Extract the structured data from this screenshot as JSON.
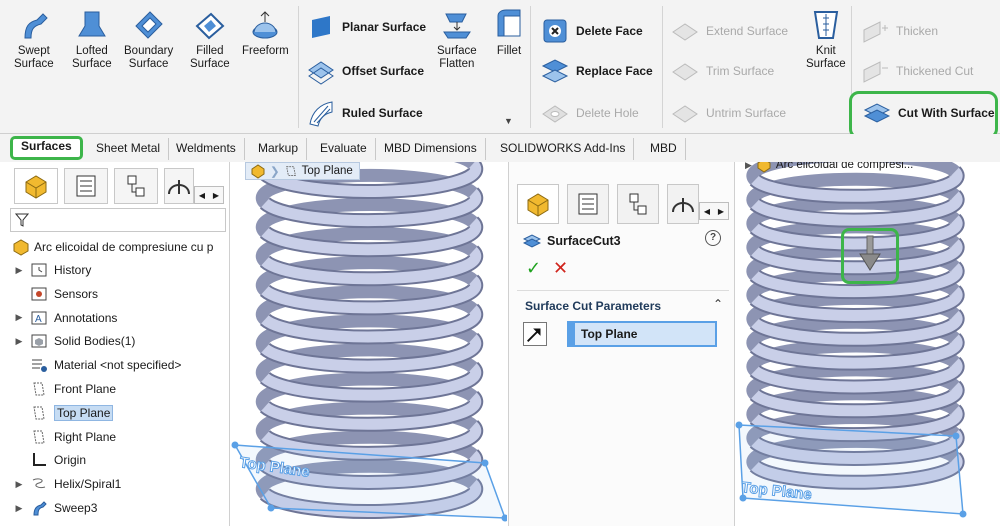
{
  "ribbon": {
    "surfaces_group": [
      {
        "label1": "Swept",
        "label2": "Surface",
        "icon": "swept-surface-icon"
      },
      {
        "label1": "Lofted",
        "label2": "Surface",
        "icon": "lofted-surface-icon"
      },
      {
        "label1": "Boundary",
        "label2": "Surface",
        "icon": "boundary-surface-icon"
      },
      {
        "label1": "Filled",
        "label2": "Surface",
        "icon": "filled-surface-icon"
      },
      {
        "label1": "Freeform",
        "label2": "",
        "icon": "freeform-icon"
      }
    ],
    "planar_surface": "Planar Surface",
    "offset_surface": "Offset Surface",
    "ruled_surface": "Ruled Surface",
    "surface_flatten_1": "Surface",
    "surface_flatten_2": "Flatten",
    "fillet": "Fillet",
    "delete_face": "Delete Face",
    "replace_face": "Replace Face",
    "delete_hole": "Delete Hole",
    "extend_surface": "Extend Surface",
    "trim_surface": "Trim Surface",
    "untrim_surface": "Untrim Surface",
    "knit_surface_1": "Knit",
    "knit_surface_2": "Surface",
    "thicken": "Thicken",
    "thickened_cut": "Thickened Cut",
    "cut_with_surface": "Cut With Surface"
  },
  "tabs": [
    "Surfaces",
    "Sheet Metal",
    "Weldments",
    "Markup",
    "Evaluate",
    "MBD Dimensions",
    "SOLIDWORKS Add-Ins",
    "MBD"
  ],
  "feature_tree": {
    "root": "Arc elicoidal de compresiune cu p",
    "items": [
      {
        "label": "History",
        "expandable": true,
        "icon": "history-icon"
      },
      {
        "label": "Sensors",
        "expandable": false,
        "icon": "sensors-icon"
      },
      {
        "label": "Annotations",
        "expandable": true,
        "icon": "annotations-icon"
      },
      {
        "label": "Solid Bodies(1)",
        "expandable": true,
        "icon": "solid-bodies-icon"
      },
      {
        "label": "Material <not specified>",
        "expandable": false,
        "icon": "material-icon"
      },
      {
        "label": "Front Plane",
        "expandable": false,
        "icon": "plane-icon"
      },
      {
        "label": "Top Plane",
        "expandable": false,
        "icon": "plane-icon",
        "selected": true
      },
      {
        "label": "Right Plane",
        "expandable": false,
        "icon": "plane-icon"
      },
      {
        "label": "Origin",
        "expandable": false,
        "icon": "origin-icon"
      },
      {
        "label": "Helix/Spiral1",
        "expandable": true,
        "icon": "helix-icon"
      },
      {
        "label": "Sweep3",
        "expandable": true,
        "icon": "sweep-icon"
      }
    ]
  },
  "viewport_left": {
    "breadcrumb": "Top Plane",
    "plane_label": "Top Plane"
  },
  "property_manager": {
    "title": "SurfaceCut3",
    "help": "?",
    "ok": "✓",
    "cancel": "✕",
    "section_title": "Surface Cut Parameters",
    "selection": "Top Plane"
  },
  "viewport_right": {
    "breadcrumb": "Arc elicoidal de compresi...",
    "plane_label": "Top Plane"
  },
  "colors": {
    "highlight_green": "#3db54a",
    "spring_fill": "#c9cfe8",
    "plane_blue": "#5aa0e6"
  }
}
